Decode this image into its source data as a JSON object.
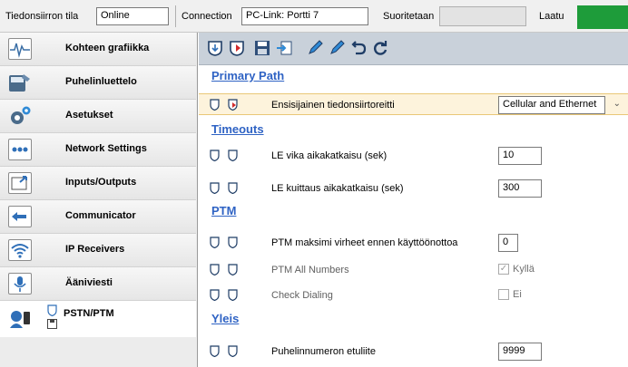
{
  "topbar": {
    "tx_state_label": "Tiedonsiirron tila",
    "tx_state_value": "Online",
    "connection_label": "Connection",
    "connection_value": "PC-Link: Portti 7",
    "running_label": "Suoritetaan",
    "quality_label": "Laatu",
    "quality_color": "#1e9c3a"
  },
  "sidebar": {
    "items": [
      {
        "label": "Kohteen grafiikka",
        "icon": "signal-graph-icon"
      },
      {
        "label": "Puhelinluettelo",
        "icon": "phonebook-icon"
      },
      {
        "label": "Asetukset",
        "icon": "gears-icon"
      },
      {
        "label": "Network Settings",
        "icon": "network-dots-icon"
      },
      {
        "label": "Inputs/Outputs",
        "icon": "inputs-outputs-icon"
      },
      {
        "label": "Communicator",
        "icon": "communicator-icon"
      },
      {
        "label": "IP Receivers",
        "icon": "wifi-icon"
      },
      {
        "label": "Ääniviesti",
        "icon": "microphone-icon"
      },
      {
        "label": "PSTN/PTM",
        "icon": "pstn-icon"
      }
    ]
  },
  "toolbar": {
    "icons": [
      "shield-down-icon",
      "shield-red-icon",
      "save-icon",
      "import-icon",
      "pencil-blue-icon",
      "pencil-blue-2-icon",
      "undo-icon",
      "refresh-icon"
    ]
  },
  "main": {
    "primary_path": {
      "title": "Primary Path",
      "rows": [
        {
          "label": "Ensisijainen tiedonsiirtoreitti",
          "value": "Cellular and Ethernet"
        }
      ]
    },
    "timeouts": {
      "title": "Timeouts",
      "rows": [
        {
          "label": "LE vika aikakatkaisu (sek)",
          "value": "10"
        },
        {
          "label": "LE kuittaus aikakatkaisu (sek)",
          "value": "300"
        }
      ]
    },
    "ptm": {
      "title": "PTM",
      "rows": [
        {
          "label": "PTM maksimi virheet ennen käyttöönottoa",
          "value": "0"
        },
        {
          "label": "PTM All Numbers",
          "checked": true,
          "value": "Kyllä"
        },
        {
          "label": "Check Dialing",
          "checked": false,
          "value": "Ei"
        }
      ]
    },
    "yleis": {
      "title": "Yleis",
      "rows": [
        {
          "label": "Puhelinnumeron etuliite",
          "value": "9999"
        }
      ]
    }
  }
}
